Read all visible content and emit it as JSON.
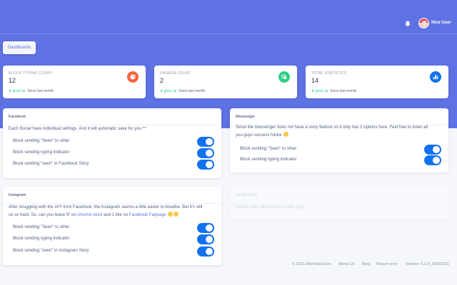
{
  "header": {
    "username": "Nice User"
  },
  "nav": {
    "dashboards_label": "Dashboards"
  },
  "stats": [
    {
      "title": "BLOCK TYPING COUNT",
      "value": "12",
      "trend": "grow up",
      "since": "Since last month",
      "icon": "pie-chart-icon",
      "color": "#fb6340"
    },
    {
      "title": "UNSEEN COUNT",
      "value": "2",
      "trend": "grow up",
      "since": "Since last month",
      "icon": "eye-slash-icon",
      "color": "#2dce89"
    },
    {
      "title": "TOTAL STATISTICS",
      "value": "14",
      "trend": "grow up",
      "since": "Since last month",
      "icon": "bar-chart-icon",
      "color": "#11cdef"
    }
  ],
  "facebook": {
    "title": "Facebook",
    "desc": "Each Social have individual settings. And it will automatic save for you ^^",
    "options": [
      {
        "label": "Block sending \"Seen\" to other",
        "on": true
      },
      {
        "label": "Block sending typing indicator",
        "on": true
      },
      {
        "label": "Block sending \"seen\" in Facebook Story",
        "on": true
      }
    ]
  },
  "messenger": {
    "title": "Messenger",
    "desc1": "Since the messenger does not have a story feature so it only has 2 options here. Feel free to listen all",
    "desc2": "you guys success future",
    "options": [
      {
        "label": "Block sending \"Seen\" to other",
        "on": true
      },
      {
        "label": "Block sending typing indicator",
        "on": true
      }
    ]
  },
  "instagram": {
    "title": "Instagram",
    "desc1": "After struggling with the sh*t from Facebook, the Instagram seems a little easier to breathe. But it's still",
    "desc2a": "so so hard. So, can you leave 5* on",
    "link1": "chrome store",
    "desc2b": "and 1 like on",
    "link2": "Facebook Fanpage",
    "options": [
      {
        "label": "Block sending \"Seen\" to other",
        "on": true
      },
      {
        "label": "Block sending typing indicator",
        "on": true
      },
      {
        "label": "Block sending \"seen\" in Instagram Story",
        "on": true
      }
    ]
  },
  "reddit": {
    "title": "Reddit Soon",
    "desc": "Reddit tools will comming soon guys"
  },
  "footer": {
    "copyright": "© 2021 AlexStack.Dev",
    "about": "About Us",
    "blog": "Blog",
    "report": "Report error",
    "version": "Version: 0.0.4_26032021"
  },
  "colors": {
    "primary": "#5e72e4",
    "toggle": "#1171ef",
    "success": "#2dce89"
  }
}
